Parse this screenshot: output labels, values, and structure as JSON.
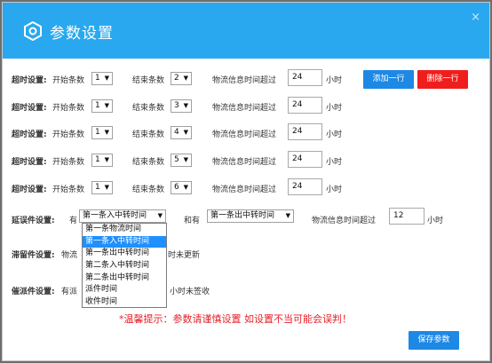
{
  "dialog": {
    "title": "参数设置",
    "close_label": "×"
  },
  "timeout_rows": [
    {
      "label": "超时设置:",
      "start_text": "开始条数",
      "start_value": "1",
      "end_text": "结束条数",
      "end_value": "2",
      "logistics_text": "物流信息时间超过",
      "hours_value": "24",
      "hours_unit": "小时"
    },
    {
      "label": "超时设置:",
      "start_text": "开始条数",
      "start_value": "1",
      "end_text": "结束条数",
      "end_value": "3",
      "logistics_text": "物流信息时间超过",
      "hours_value": "24",
      "hours_unit": "小时"
    },
    {
      "label": "超时设置:",
      "start_text": "开始条数",
      "start_value": "1",
      "end_text": "结束条数",
      "end_value": "4",
      "logistics_text": "物流信息时间超过",
      "hours_value": "24",
      "hours_unit": "小时"
    },
    {
      "label": "超时设置:",
      "start_text": "开始条数",
      "start_value": "1",
      "end_text": "结束条数",
      "end_value": "5",
      "logistics_text": "物流信息时间超过",
      "hours_value": "24",
      "hours_unit": "小时"
    },
    {
      "label": "超时设置:",
      "start_text": "开始条数",
      "start_value": "1",
      "end_text": "结束条数",
      "end_value": "6",
      "logistics_text": "物流信息时间超过",
      "hours_value": "24",
      "hours_unit": "小时"
    }
  ],
  "buttons": {
    "add_row": "添加一行",
    "delete_row": "删除一行",
    "save": "保存参数"
  },
  "delay": {
    "label": "延误件设置:",
    "has_text": "有",
    "select_value": "第一条入中转时间",
    "and_text": "和有",
    "select2_value": "第一条出中转时间",
    "logistics_text": "物流信息时间超过",
    "hours_value": "12",
    "hours_unit": "小时"
  },
  "dropdown_options": [
    "第一条物流时间",
    "第一条入中转时间",
    "第一条出中转时间",
    "第二条入中转时间",
    "第二条出中转时间",
    "派件时间",
    "收件时间"
  ],
  "dropdown_selected_index": 1,
  "stagnant": {
    "label": "滞留件设置:",
    "text_visible": "物流",
    "suffix": "时未更新"
  },
  "urge": {
    "label": "催派件设置:",
    "text_visible": "有派",
    "suffix": "小时未签收"
  },
  "warning": "*温馨提示：参数请谨慎设置 如设置不当可能会误判！",
  "colors": {
    "header": "#29a8ef",
    "primary_button": "#1e88e5",
    "danger_button": "#f01d1d",
    "warning_text": "#e8202a"
  }
}
